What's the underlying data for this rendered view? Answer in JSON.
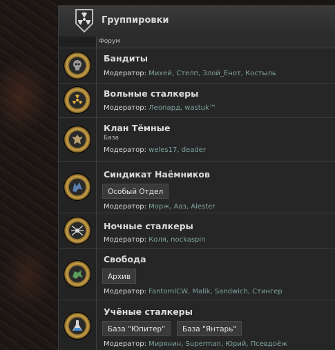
{
  "header": {
    "title": "Группировки",
    "column_label": "Форум"
  },
  "moderator_label": "Модератор:",
  "forums": [
    {
      "name": "Бандиты",
      "moderators": "Михей, Стелп, Злой_Енот, Костыль"
    },
    {
      "name": "Вольные сталкеры",
      "moderators": "Леопард, wastuk™"
    },
    {
      "name": "Клан Тёмные",
      "subtitle": "База",
      "moderators": "weles17, deader"
    },
    {
      "name": "Синдикат Наёмников",
      "subforums": [
        "Особый Отдел"
      ],
      "moderators": "Морж, Aaз, Alester"
    },
    {
      "name": "Ночные сталкеры",
      "moderators": "Коля, nockaspin"
    },
    {
      "name": "Свобода",
      "subforums": [
        "Архив"
      ],
      "moderators": "FantomICW, Malik, Sandwich, Стингер"
    },
    {
      "name": "Учёные сталкеры",
      "subforums": [
        "База \"Юпитер\"",
        "База \"Янтарь\""
      ],
      "moderators": "Мирянин, Superman, Юрий, Псевдоёж"
    }
  ],
  "colors": {
    "accent_link": "#7fa3a0",
    "emblem_gold": "#c9a24a"
  },
  "icons": [
    "radiation-hazard-icon",
    "skull-emblem-icon",
    "nuclear-emblem-icon",
    "eagle-emblem-icon",
    "wolf-emblem-icon",
    "spider-emblem-icon",
    "dragon-emblem-icon",
    "flask-emblem-icon"
  ]
}
